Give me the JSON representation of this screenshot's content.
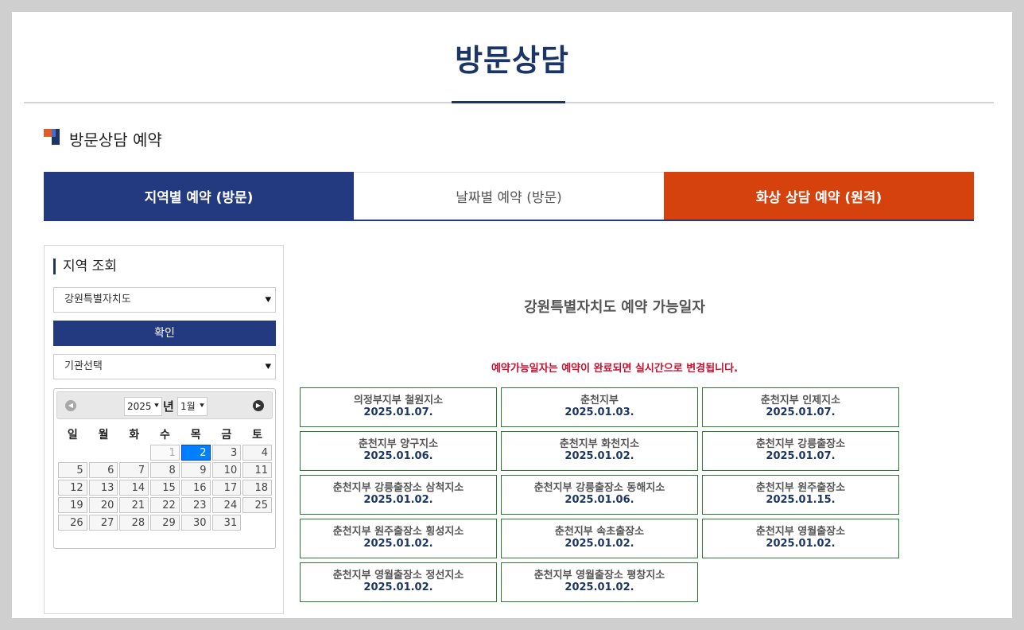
{
  "page": {
    "title": "방문상담"
  },
  "section": {
    "title": "방문상담 예약"
  },
  "tabs": [
    {
      "label": "지역별 예약 (방문)",
      "active": true,
      "color": "#243a80"
    },
    {
      "label": "날짜별 예약 (방문)",
      "active": false,
      "color": "#ffffff"
    },
    {
      "label": "화상 상담 예약 (원격)",
      "active": false,
      "color": "#d6420e"
    }
  ],
  "sidebar": {
    "title": "지역 조회",
    "region_select": {
      "value": "강원특별자치도"
    },
    "confirm_label": "확인",
    "agency_select": {
      "value": "기관선택"
    },
    "calendar": {
      "year": "2025",
      "year_suffix": "년",
      "month": "1월",
      "weekdays": [
        "일",
        "월",
        "화",
        "수",
        "목",
        "금",
        "토"
      ],
      "weeks": [
        [
          "",
          "",
          "",
          "1",
          "2",
          "3",
          "4"
        ],
        [
          "5",
          "6",
          "7",
          "8",
          "9",
          "10",
          "11"
        ],
        [
          "12",
          "13",
          "14",
          "15",
          "16",
          "17",
          "18"
        ],
        [
          "19",
          "20",
          "21",
          "22",
          "23",
          "24",
          "25"
        ],
        [
          "26",
          "27",
          "28",
          "29",
          "30",
          "31",
          ""
        ]
      ],
      "today": "2",
      "disabled": [
        "1"
      ]
    }
  },
  "main": {
    "title": "강원특별자치도 예약 가능일자",
    "note": "예약가능일자는 예약이 완료되면 실시간으로 변경됩니다.",
    "offices": [
      {
        "name": "의정부지부 철원지소",
        "date": "2025.01.07."
      },
      {
        "name": "춘천지부",
        "date": "2025.01.03."
      },
      {
        "name": "춘천지부 인제지소",
        "date": "2025.01.07."
      },
      {
        "name": "춘천지부 양구지소",
        "date": "2025.01.06."
      },
      {
        "name": "춘천지부 화천지소",
        "date": "2025.01.02."
      },
      {
        "name": "춘천지부 강릉출장소",
        "date": "2025.01.07."
      },
      {
        "name": "춘천지부 강릉출장소 삼척지소",
        "date": "2025.01.02."
      },
      {
        "name": "춘천지부 강릉출장소 동해지소",
        "date": "2025.01.06."
      },
      {
        "name": "춘천지부 원주출장소",
        "date": "2025.01.15."
      },
      {
        "name": "춘천지부 원주출장소 횡성지소",
        "date": "2025.01.02."
      },
      {
        "name": "춘천지부 속초출장소",
        "date": "2025.01.02."
      },
      {
        "name": "춘천지부 영월출장소",
        "date": "2025.01.02."
      },
      {
        "name": "춘천지부 영월출장소 정선지소",
        "date": "2025.01.02."
      },
      {
        "name": "춘천지부 영월출장소 평창지소",
        "date": "2025.01.02."
      }
    ]
  }
}
